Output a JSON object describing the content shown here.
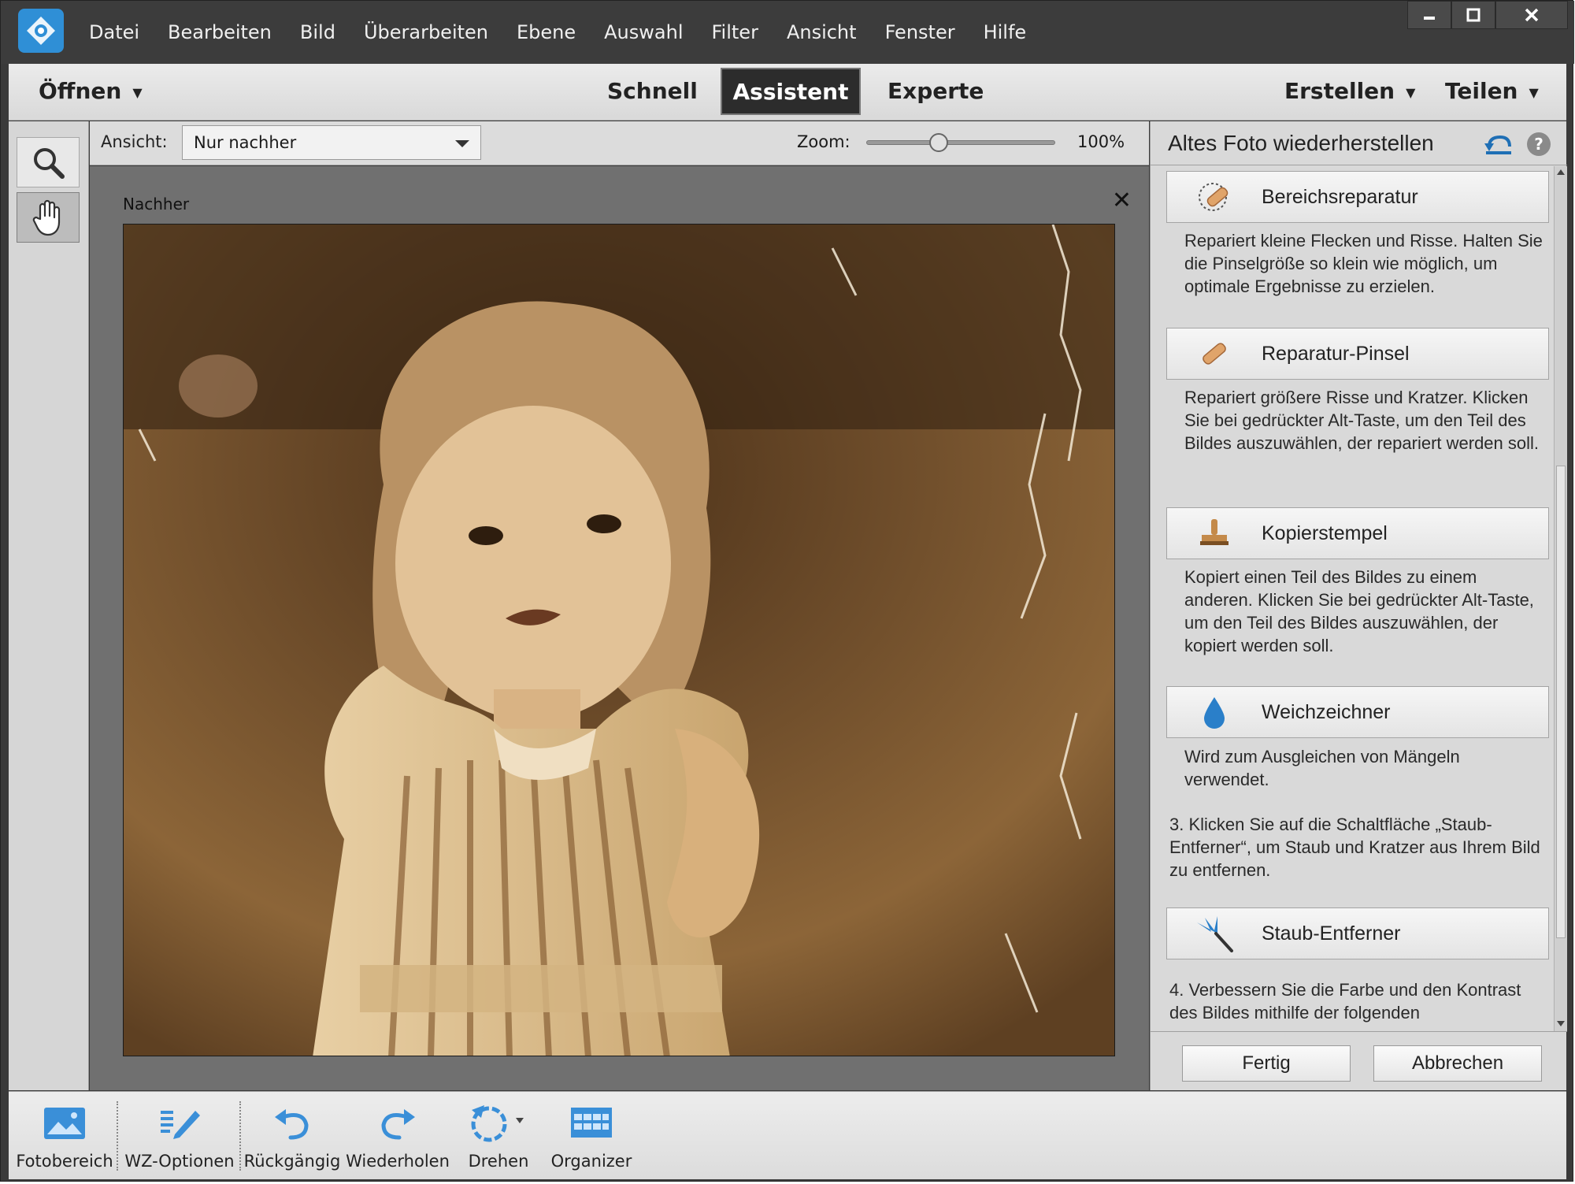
{
  "menu": {
    "items": [
      "Datei",
      "Bearbeiten",
      "Bild",
      "Überarbeiten",
      "Ebene",
      "Auswahl",
      "Filter",
      "Ansicht",
      "Fenster",
      "Hilfe"
    ]
  },
  "window_controls": {
    "minimize": "▬",
    "maximize": "▢",
    "close": "✕"
  },
  "modebar": {
    "open": "Öffnen",
    "tabs": {
      "quick": "Schnell",
      "guided": "Assistent",
      "expert": "Experte"
    },
    "active_tab": "Assistent",
    "create": "Erstellen",
    "share": "Teilen"
  },
  "options": {
    "view_label": "Ansicht:",
    "view_value": "Nur nachher",
    "zoom_label": "Zoom:",
    "zoom_value": "100%",
    "zoom_slider_fraction": 0.37
  },
  "canvas": {
    "doc_label": "Nachher",
    "close": "✕"
  },
  "panel": {
    "title": "Altes Foto wiederherstellen",
    "tools": [
      {
        "label": "Bereichsreparatur",
        "icon": "spot-healing-icon",
        "desc": "Repariert kleine Flecken und Risse. Halten Sie die Pinselgröße so klein wie möglich, um optimale Ergebnisse zu erzielen."
      },
      {
        "label": "Reparatur-Pinsel",
        "icon": "healing-brush-icon",
        "desc": "Repariert größere Risse und Kratzer. Klicken Sie bei gedrückter Alt-Taste, um den Teil des Bildes auszuwählen, der repariert werden soll."
      },
      {
        "label": "Kopierstempel",
        "icon": "clone-stamp-icon",
        "desc": "Kopiert einen Teil des Bildes zu einem anderen. Klicken Sie bei gedrückter Alt-Taste, um den Teil des Bildes auszuwählen, der kopiert werden soll."
      },
      {
        "label": "Weichzeichner",
        "icon": "blur-drop-icon",
        "desc": "Wird zum Ausgleichen von Mängeln verwendet."
      }
    ],
    "step3": "3. Klicken Sie auf die Schaltfläche „Staub-Entferner“, um Staub und Kratzer aus Ihrem Bild zu entfernen.",
    "dust_tool": {
      "label": "Staub-Entferner",
      "icon": "dust-scratches-icon"
    },
    "step4": "4. Verbessern Sie die Farbe und den Kontrast des Bildes mithilfe der folgenden",
    "done": "Fertig",
    "cancel": "Abbrechen"
  },
  "bottombar": {
    "items": [
      {
        "label": "Fotobereich",
        "icon": "photo-bin-icon"
      },
      {
        "label": "WZ-Optionen",
        "icon": "tool-options-icon"
      },
      {
        "label": "Rückgängig",
        "icon": "undo-icon"
      },
      {
        "label": "Wiederholen",
        "icon": "redo-icon"
      },
      {
        "label": "Drehen",
        "icon": "rotate-icon"
      },
      {
        "label": "Organizer",
        "icon": "organizer-icon"
      }
    ]
  },
  "colors": {
    "accent": "#2f8fd6",
    "dark_chrome": "#3c3c3c",
    "panel_bg": "#d9d9d9",
    "photo_sepia": "#8a6236"
  }
}
